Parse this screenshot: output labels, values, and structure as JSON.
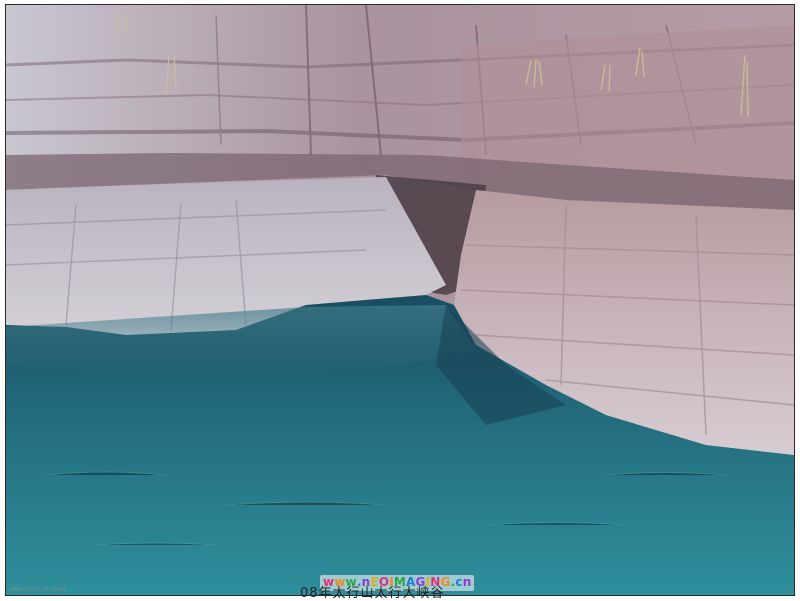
{
  "photo": {
    "subject": "red-sandstone canyon cliff over a turquoise pool"
  },
  "watermark": {
    "text": "www.nEOIMAGING.cn"
  },
  "caption": {
    "text": "08年太行山太行大峡谷"
  },
  "camera_stamp": {
    "text": "2008/07/13 14:50:09"
  },
  "colors": {
    "water_dark": "#1c4f62",
    "water_light": "#2f8c9a",
    "rock_pink": "#b89aa6",
    "rock_light": "#d8d2d8",
    "rock_shadow": "#5c4a52",
    "frame": "#ffffff"
  }
}
